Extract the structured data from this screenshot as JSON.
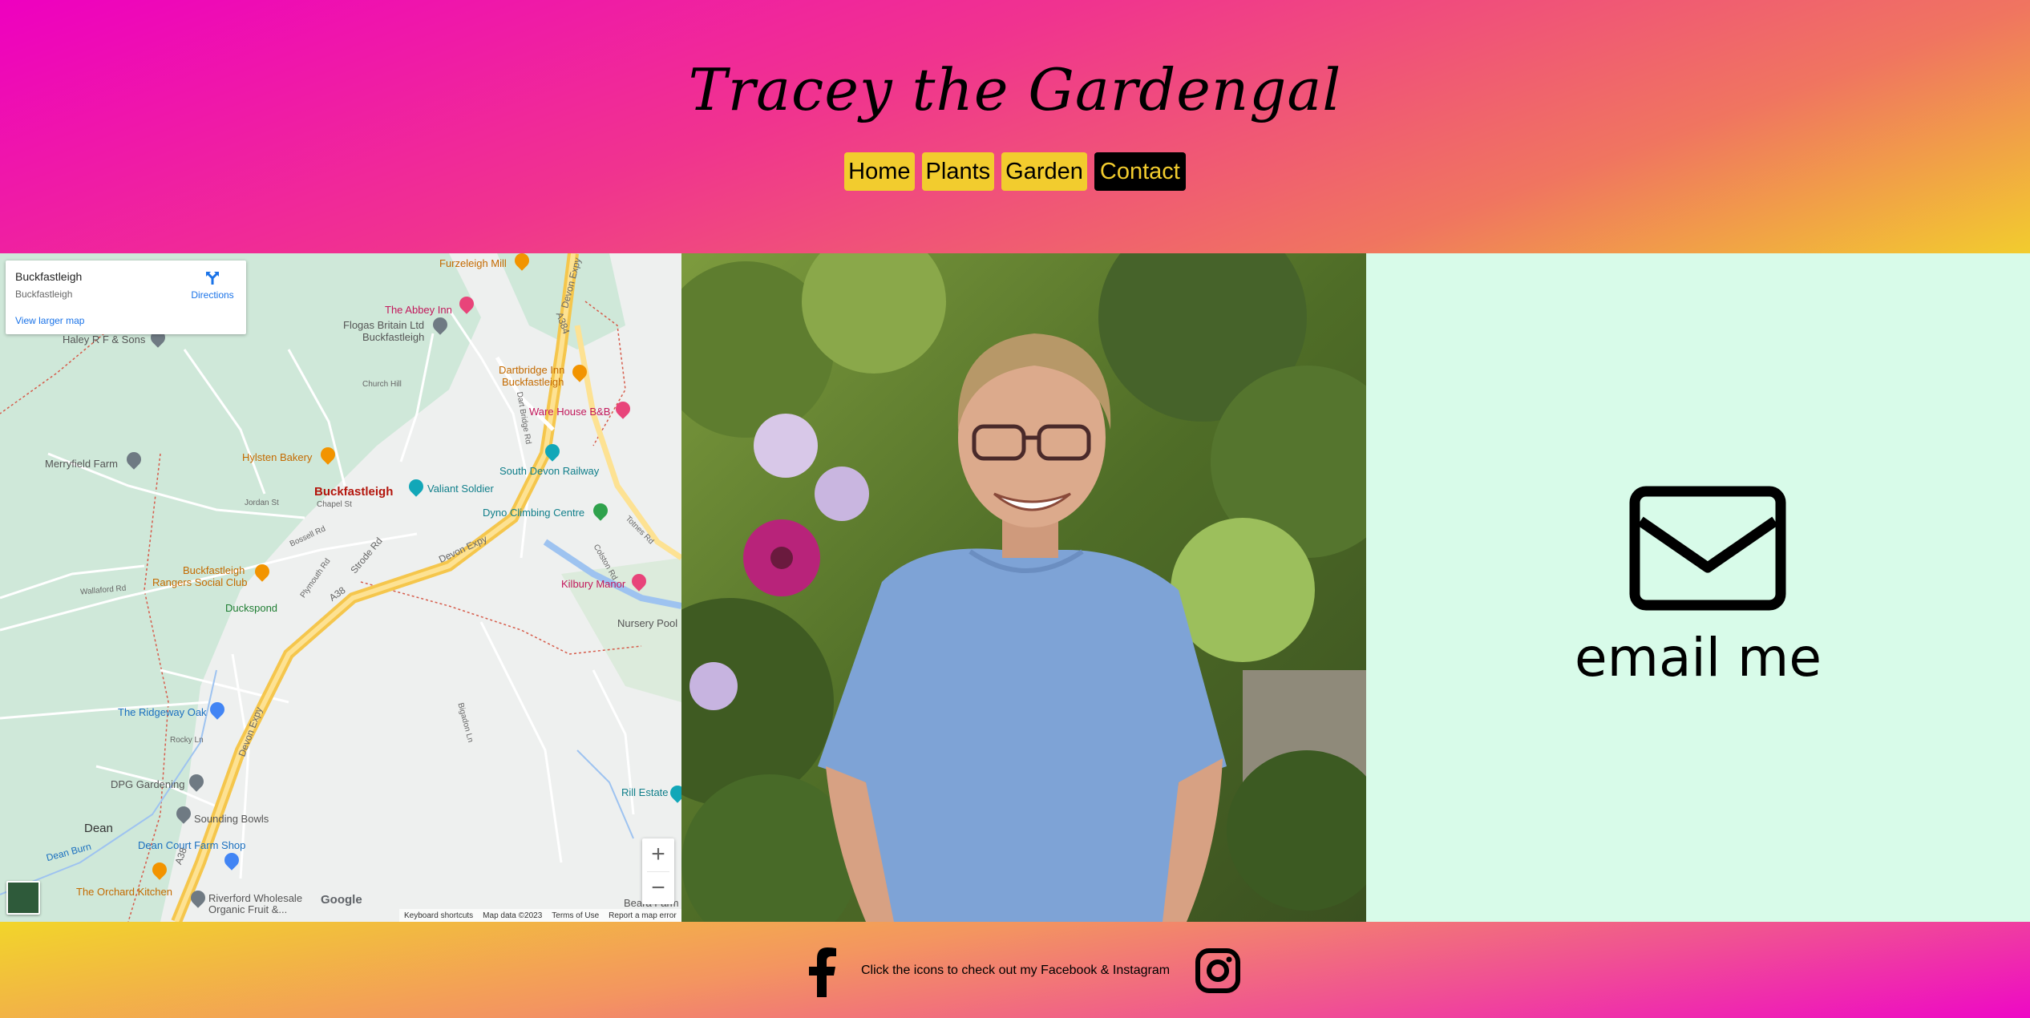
{
  "header": {
    "title": "Tracey the Gardengal",
    "nav": [
      {
        "label": "Home",
        "active": false
      },
      {
        "label": "Plants",
        "active": false
      },
      {
        "label": "Garden",
        "active": false
      },
      {
        "label": "Contact",
        "active": true
      }
    ],
    "gradient_colors": [
      "#ee00c0",
      "#f2cc2e"
    ]
  },
  "map": {
    "card": {
      "title": "Buckfastleigh",
      "subtitle": "Buckfastleigh",
      "link": "View larger map",
      "directions": "Directions"
    },
    "places": {
      "furzeleigh_mill": "Furzeleigh Mill",
      "abbey_inn": "The Abbey Inn",
      "flogas": "Flogas Britain Ltd",
      "flogas2": "Buckfastleigh",
      "haley": "Haley R F & Sons",
      "dartbridge": "Dartbridge Inn",
      "dartbridge2": "Buckfastleigh",
      "warehouse": "Ware House B&B",
      "merryfield": "Merryfield Farm",
      "hylsten": "Hylsten Bakery",
      "south_devon_railway": "South Devon Railway",
      "town": "Buckfastleigh",
      "valiant": "Valiant Soldier",
      "dyno": "Dyno Climbing Centre",
      "rangers": "Buckfastleigh",
      "rangers2": "Rangers Social Club",
      "kilbury": "Kilbury Manor",
      "duckspond": "Duckspond",
      "nursery_pool": "Nursery Pool",
      "ridgeway": "The Ridgeway Oak",
      "dpg": "DPG Gardening",
      "sounding_bowls": "Sounding Bowls",
      "rill": "Rill Estate",
      "dean": "Dean",
      "dean_court": "Dean Court Farm Shop",
      "dean_burn": "Dean Burn",
      "orchard": "The Orchard Kitchen",
      "riverford": "Riverford Wholesale",
      "riverford2": "Organic Fruit &...",
      "beara": "Beara Farm"
    },
    "roads": {
      "devon_expy_a": "Devon Expy",
      "devon_expy_b": "Devon Expy",
      "devon_expy_c": "Devon Expy",
      "a384": "A384",
      "a38_a": "A38",
      "a38_b": "A38",
      "dart_bridge": "Dart Bridge Rd",
      "church_hill": "Church Hill",
      "chapel_st": "Chapel St",
      "jordan_st": "Jordan St",
      "bossell": "Bossell Rd",
      "plymouth": "Plymouth Rd",
      "strode": "Strode Rd",
      "totnes": "Totnes Rd",
      "colston": "Colston Rd",
      "wallaford": "Wallaford Rd",
      "rocky": "Rocky Ln",
      "bigadon": "Bigadon Ln"
    },
    "zoom_in": "+",
    "zoom_out": "−",
    "logo": "Google",
    "footer": {
      "shortcuts": "Keyboard shortcuts",
      "data": "Map data ©2023",
      "terms": "Terms of Use",
      "report": "Report a map error"
    }
  },
  "email": {
    "label": "email me",
    "icon": "envelope-icon",
    "background": "#d8fbe9"
  },
  "footer": {
    "text": "Click the icons to check out my Facebook & Instagram",
    "icons": [
      "facebook-icon",
      "instagram-icon"
    ]
  }
}
